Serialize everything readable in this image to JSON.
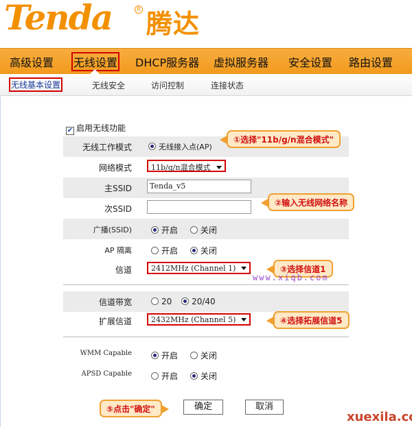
{
  "brand": {
    "name_en": "Tenda",
    "name_cn": "腾达",
    "reg_mark": "R",
    "color": "#f39000"
  },
  "main_nav": {
    "items": [
      "高级设置",
      "无线设置",
      "DHCP服务器",
      "虚拟服务器",
      "安全设置",
      "路由设置"
    ],
    "active": "无线设置"
  },
  "sub_nav": {
    "items": [
      "无线基本设置",
      "无线安全",
      "访问控制",
      "连接状态"
    ],
    "active": "无线基本设置"
  },
  "form": {
    "enable_wireless": {
      "label": "启用无线功能",
      "checked": true,
      "check_glyph": "✔"
    },
    "work_mode": {
      "label": "无线工作模式",
      "value": "无线接入点(AP)"
    },
    "network_mode": {
      "label": "网络模式",
      "value": "11b/g/n混合模式"
    },
    "primary_ssid": {
      "label": "主SSID",
      "value": "Tenda_v5"
    },
    "secondary_ssid": {
      "label": "次SSID",
      "value": ""
    },
    "broadcast": {
      "label": "广播(SSID)",
      "options": [
        "开启",
        "关闭"
      ],
      "selected": "开启"
    },
    "ap_isolation": {
      "label": "AP 隔离",
      "options": [
        "开启",
        "关闭"
      ],
      "selected": "关闭"
    },
    "channel": {
      "label": "信道",
      "value": "2412MHz (Channel 1)"
    },
    "bandwidth": {
      "label": "信道带宽",
      "options": [
        "20",
        "20/40"
      ],
      "selected": "20/40"
    },
    "ext_channel": {
      "label": "扩展信道",
      "value": "2432MHz (Channel 5)"
    },
    "wmm": {
      "label": "WMM Capable",
      "options": [
        "开启",
        "关闭"
      ],
      "selected": "开启"
    },
    "apsd": {
      "label": "APSD Capable",
      "options": [
        "开启",
        "关闭"
      ],
      "selected": "关闭"
    }
  },
  "buttons": {
    "ok": "确定",
    "cancel": "取消"
  },
  "callouts": {
    "c1": "①选择\"11b/g/n混合模式\"",
    "c2": "②输入无线网络名称",
    "c3": "③选择信道1",
    "c4": "④选择拓展信道5",
    "c5": "⑤点击\"确定\""
  },
  "watermarks": {
    "w1": "www.xiqb.com",
    "w2": "xuexila.com"
  }
}
